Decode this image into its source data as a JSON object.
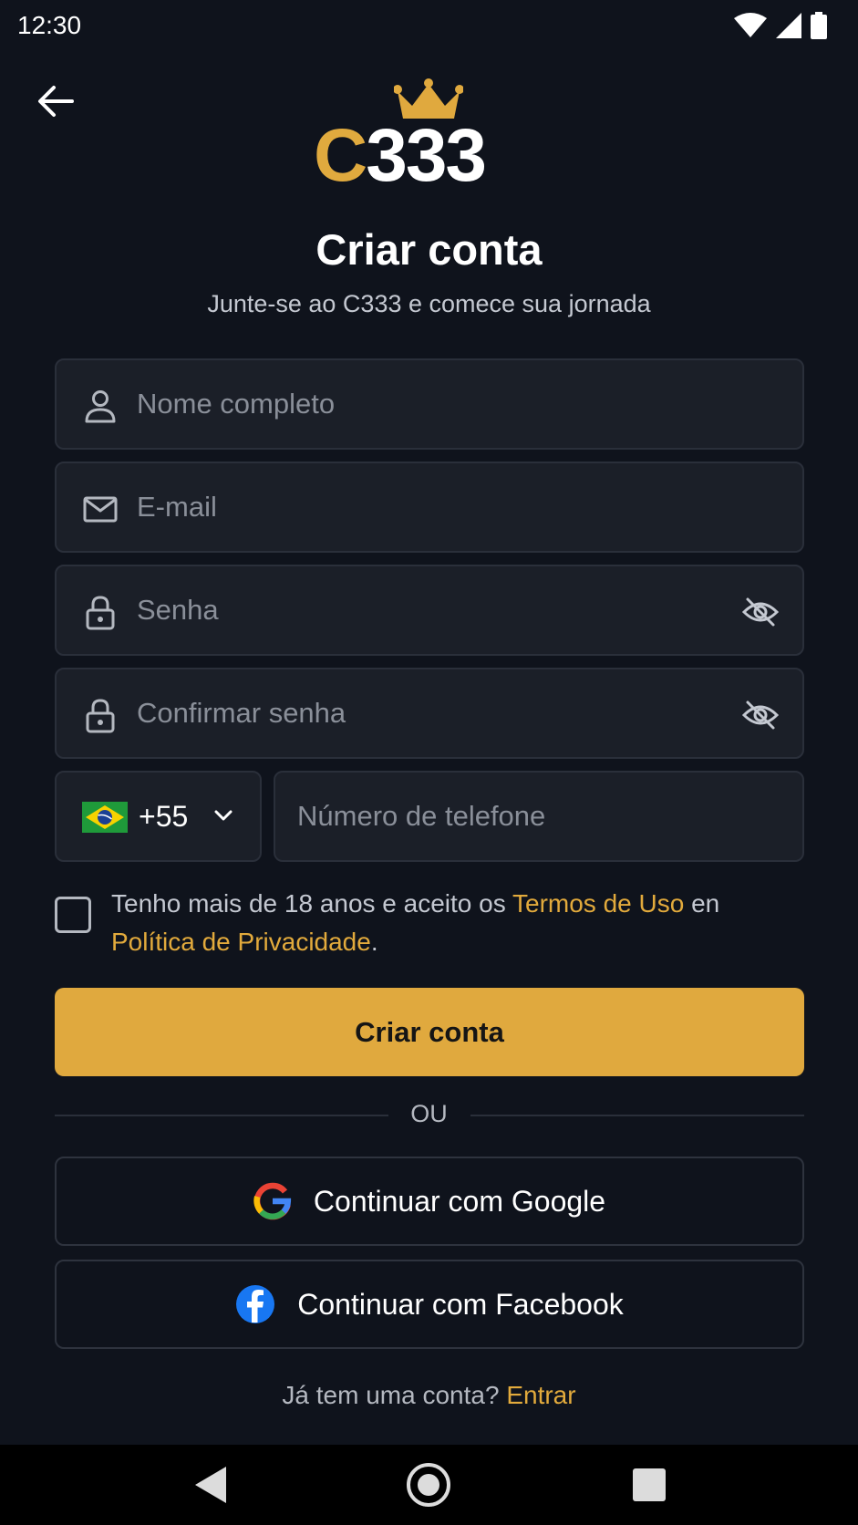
{
  "status_bar": {
    "time": "12:30"
  },
  "brand": {
    "logo_c": "C",
    "logo_num": "333",
    "accent": "#e0a93e"
  },
  "header": {
    "title": "Criar conta",
    "subtitle": "Junte-se ao C333 e comece sua jornada"
  },
  "form": {
    "name_placeholder": "Nome completo",
    "email_placeholder": "E-mail",
    "password_placeholder": "Senha",
    "confirm_placeholder": "Confirmar senha",
    "country_code": "+55",
    "country_flag": "brazil-flag",
    "phone_placeholder": "Número de telefone"
  },
  "terms": {
    "prefix": "Tenho mais de 18 anos e aceito os ",
    "terms_link": "Termos de Uso",
    "middle": " en ",
    "privacy_link": "Política de Privacidade",
    "suffix": "."
  },
  "actions": {
    "submit": "Criar conta",
    "divider": "OU",
    "google": "Continuar com Google",
    "facebook": "Continuar com Facebook"
  },
  "footer": {
    "prompt": "Já tem uma conta? ",
    "login_link": "Entrar"
  }
}
